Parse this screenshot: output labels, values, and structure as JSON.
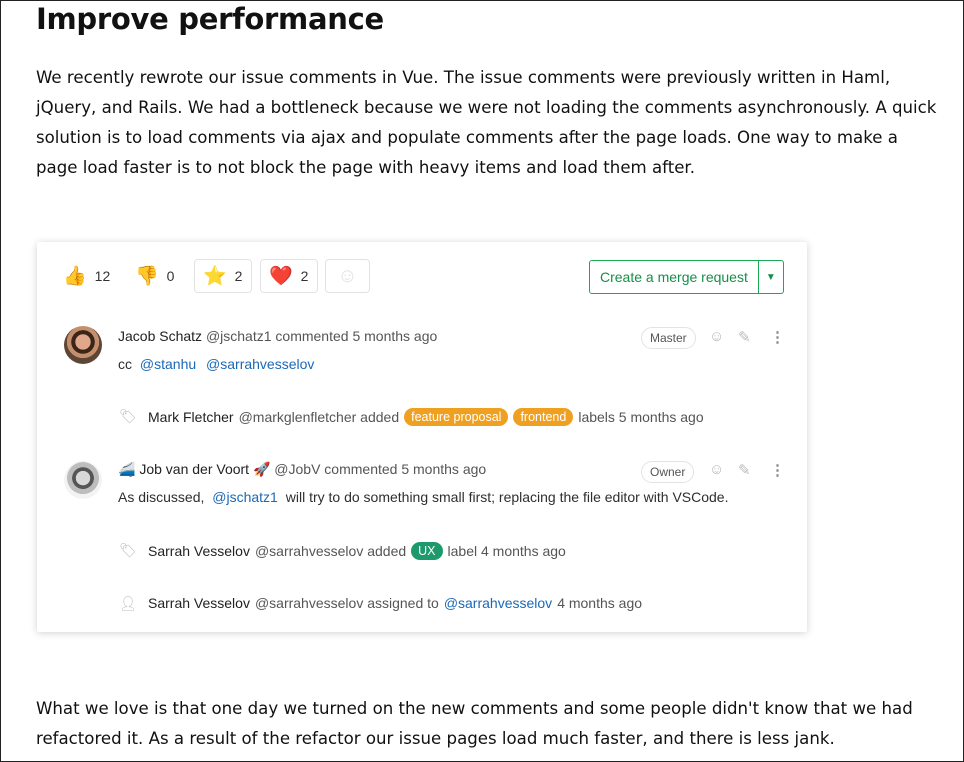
{
  "article": {
    "heading": "Improve performance",
    "paragraph1": "We recently rewrote our issue comments in Vue. The issue comments were previously written in Haml, jQuery, and Rails. We had a bottleneck because we were not loading the comments asynchronously. A quick solution is to load comments via ajax and populate comments after the page loads. One way to make a page load faster is to not block the page with heavy items and load them after.",
    "paragraph2": "What we love is that one day we turned on the new comments and some people didn't know that we had refactored it. As a result of the refactor our issue pages load much faster, and there is less jank."
  },
  "awards": [
    {
      "icon": "thumbsup-icon",
      "glyph": "👍",
      "count": "12"
    },
    {
      "icon": "thumbsdown-icon",
      "glyph": "👎",
      "count": "0"
    },
    {
      "icon": "star-icon",
      "glyph": "⭐",
      "count": "2"
    },
    {
      "icon": "heart-icon",
      "glyph": "❤️",
      "count": "2"
    },
    {
      "icon": "add-reaction-icon",
      "glyph": "☺",
      "count": ""
    }
  ],
  "merge_request": {
    "label": "Create a merge request",
    "caret": "▼"
  },
  "notes": [
    {
      "author": "Jacob Schatz",
      "meta": "@jschatz1 commented 5 months ago",
      "role": "Master",
      "body_prefix": "cc",
      "mentions": [
        "@stanhu",
        "@sarrahvesselov"
      ]
    },
    {
      "author": "Job van der Voort",
      "prefix_glyph": "🚄",
      "suffix_glyph": "🚀",
      "meta": "@JobV commented 5 months ago",
      "role": "Owner",
      "body_prefix": "As discussed,",
      "mention": "@jschatz1",
      "body_suffix": "will try to do something small first; replacing the file editor with VSCode."
    }
  ],
  "system_notes": [
    {
      "icon": "tag-icon",
      "who": "Mark Fletcher",
      "handle": "@markglenfletcher added",
      "labels": [
        {
          "text": "feature proposal",
          "color": "#f0a020"
        },
        {
          "text": "frontend",
          "color": "#f0a020"
        }
      ],
      "suffix": "labels 5 months ago"
    },
    {
      "icon": "tag-icon",
      "who": "Sarrah Vesselov",
      "handle": "@sarrahvesselov added",
      "labels": [
        {
          "text": "UX",
          "color": "#1c9a6c"
        }
      ],
      "suffix": "label 4 months ago"
    },
    {
      "icon": "user-icon",
      "who": "Sarrah Vesselov",
      "handle": "@sarrahvesselov assigned to",
      "mention": "@sarrahvesselov",
      "suffix": "4 months ago"
    }
  ],
  "note_actions": {
    "smile": "☺",
    "pencil": "✎",
    "more": "⋮"
  }
}
